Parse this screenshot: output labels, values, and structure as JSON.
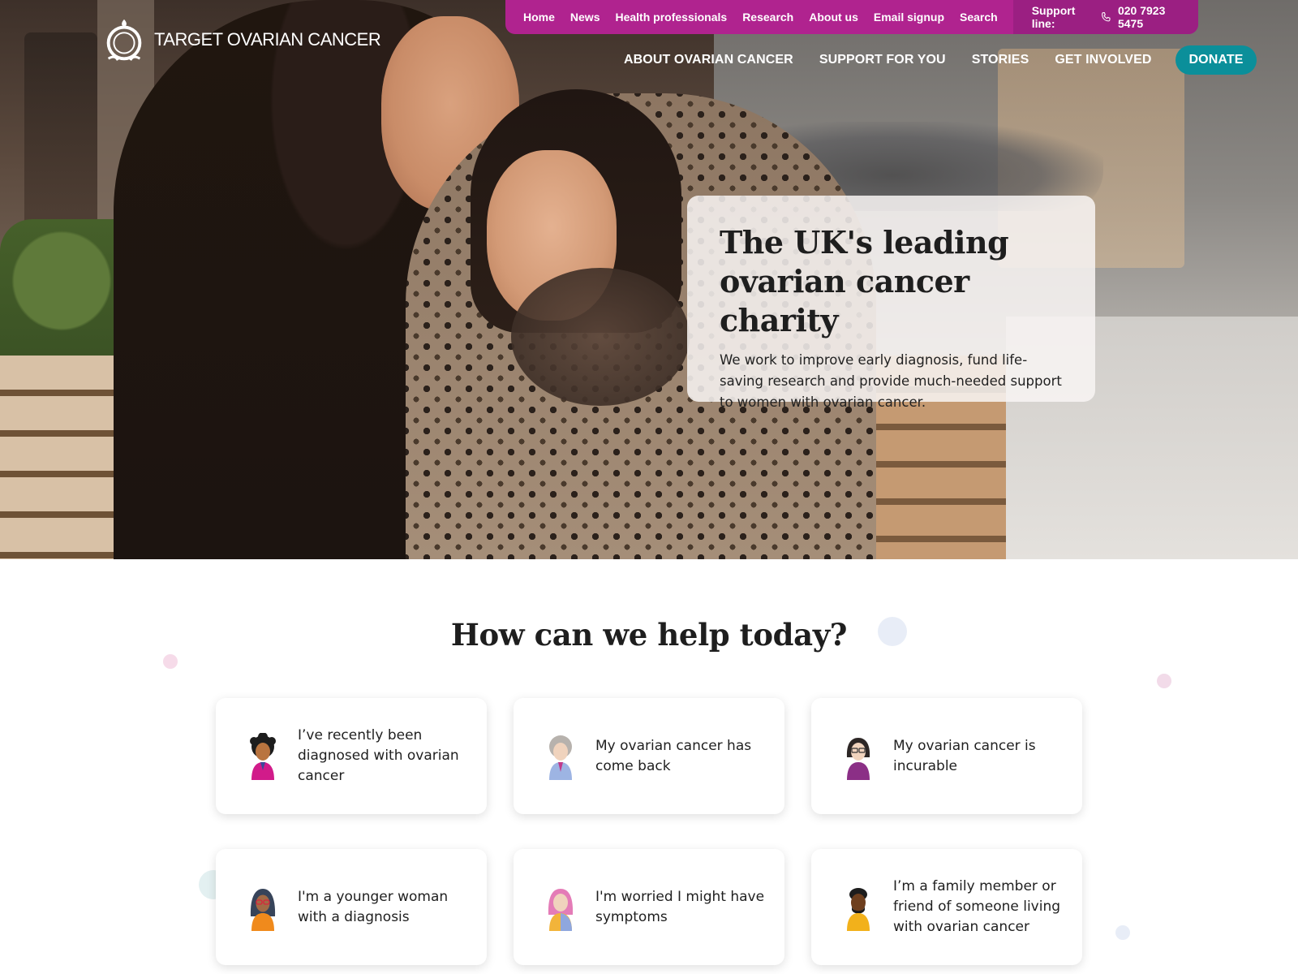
{
  "brand": {
    "name": "TARGET OVARIAN CANCER"
  },
  "utility_nav": {
    "links": [
      "Home",
      "News",
      "Health professionals",
      "Research",
      "About us",
      "Email signup",
      "Search"
    ],
    "support_label": "Support line:",
    "support_phone": "020 7923 5475"
  },
  "main_nav": {
    "links": [
      "ABOUT OVARIAN CANCER",
      "SUPPORT FOR YOU",
      "STORIES",
      "GET INVOLVED"
    ],
    "donate_label": "DONATE"
  },
  "hero": {
    "title": "The UK's leading ovarian cancer charity",
    "text": "We work to improve early diagnosis, fund life-saving research and provide much-needed support to women with ovarian cancer."
  },
  "help": {
    "title": "How can we help today?",
    "cards": [
      {
        "label": "I’ve recently been diagnosed with ovarian cancer",
        "icon": "avatar-curly-hair-icon"
      },
      {
        "label": "My ovarian cancer has come back",
        "icon": "avatar-grey-hair-icon"
      },
      {
        "label": "My ovarian cancer is incurable",
        "icon": "avatar-glasses-icon"
      },
      {
        "label": "I'm a younger woman with a diagnosis",
        "icon": "avatar-headscarf-icon"
      },
      {
        "label": "I'm worried I might have symptoms",
        "icon": "avatar-pink-hair-icon"
      },
      {
        "label": "I’m a family member or friend of someone living with ovarian cancer",
        "icon": "avatar-man-icon"
      }
    ]
  },
  "colors": {
    "utility_bar": "#b0238f",
    "donate": "#0b8f9a",
    "text": "#1e1e1e"
  }
}
